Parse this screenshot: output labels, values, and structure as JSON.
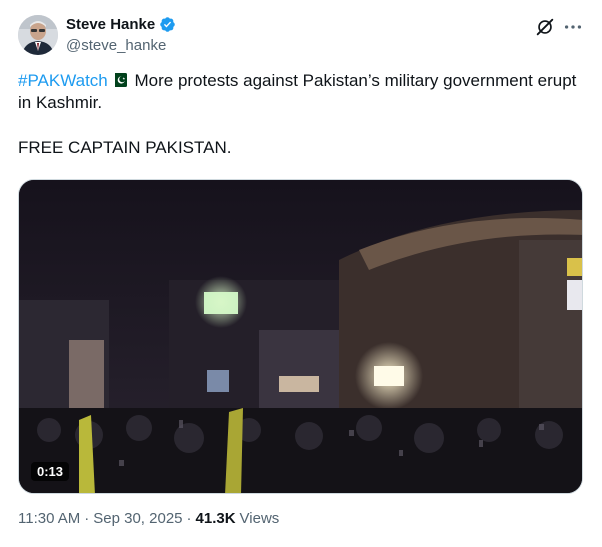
{
  "author": {
    "name": "Steve Hanke",
    "handle": "@steve_hanke"
  },
  "tweet": {
    "hashtag": "#PAKWatch",
    "flag": "Pakistan flag",
    "line1": " More protests against Pakistan’s military government erupt in Kashmir.",
    "line2": "FREE CAPTAIN PAKISTAN."
  },
  "video": {
    "duration": "0:13"
  },
  "meta": {
    "time": "11:30 AM",
    "separator": "·",
    "date": "Sep 30, 2025",
    "views_count": "41.3K",
    "views_label": "Views"
  },
  "colors": {
    "accent": "#1d9bf0",
    "secondary_text": "#536471",
    "verified": "#1d9bf0"
  },
  "icons": [
    "verified-badge-icon",
    "grok-icon",
    "more-options-icon"
  ]
}
